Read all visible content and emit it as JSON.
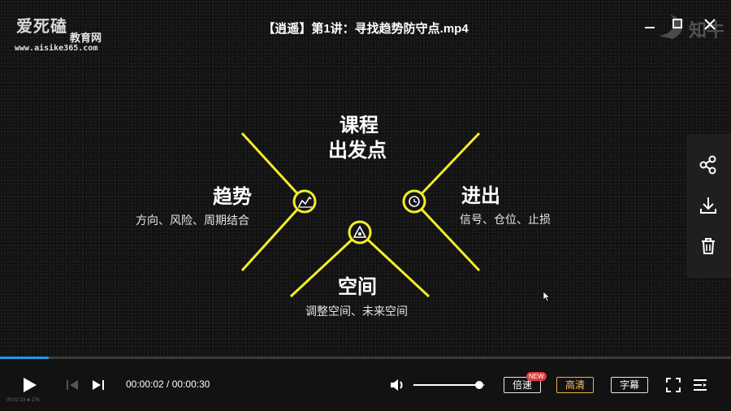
{
  "window": {
    "title": "【逍遥】第1讲：寻找趋势防守点.mp4",
    "brand_text": "知牛"
  },
  "watermark": {
    "logo_main": "爱死磕",
    "logo_sub": "教育网",
    "url": "www.aisike365.com"
  },
  "slide": {
    "center": {
      "line1": "课程",
      "line2": "出发点"
    },
    "left": {
      "heading": "趋势",
      "sub": "方向、风险、周期结合"
    },
    "right": {
      "heading": "进出",
      "sub": "信号、仓位、止损"
    },
    "bottom": {
      "heading": "空间",
      "sub": "调整空间、未来空间"
    },
    "accent_color": "#f2ee2a"
  },
  "side_panel": {
    "icons": [
      "share-icon",
      "download-icon",
      "trash-icon"
    ]
  },
  "player": {
    "progress_fraction": 0.067,
    "current_time": "00:00:02",
    "separator": " / ",
    "total_time": "00:00:30",
    "volume_fraction": 0.93,
    "speed_label": "倍速",
    "new_badge": "NEW",
    "quality_label": "高清",
    "subtitle_label": "字幕",
    "status_small": "00:02:23  ♣ 176",
    "progress_color": "#1e9be0",
    "quality_color": "#f0b04a"
  }
}
